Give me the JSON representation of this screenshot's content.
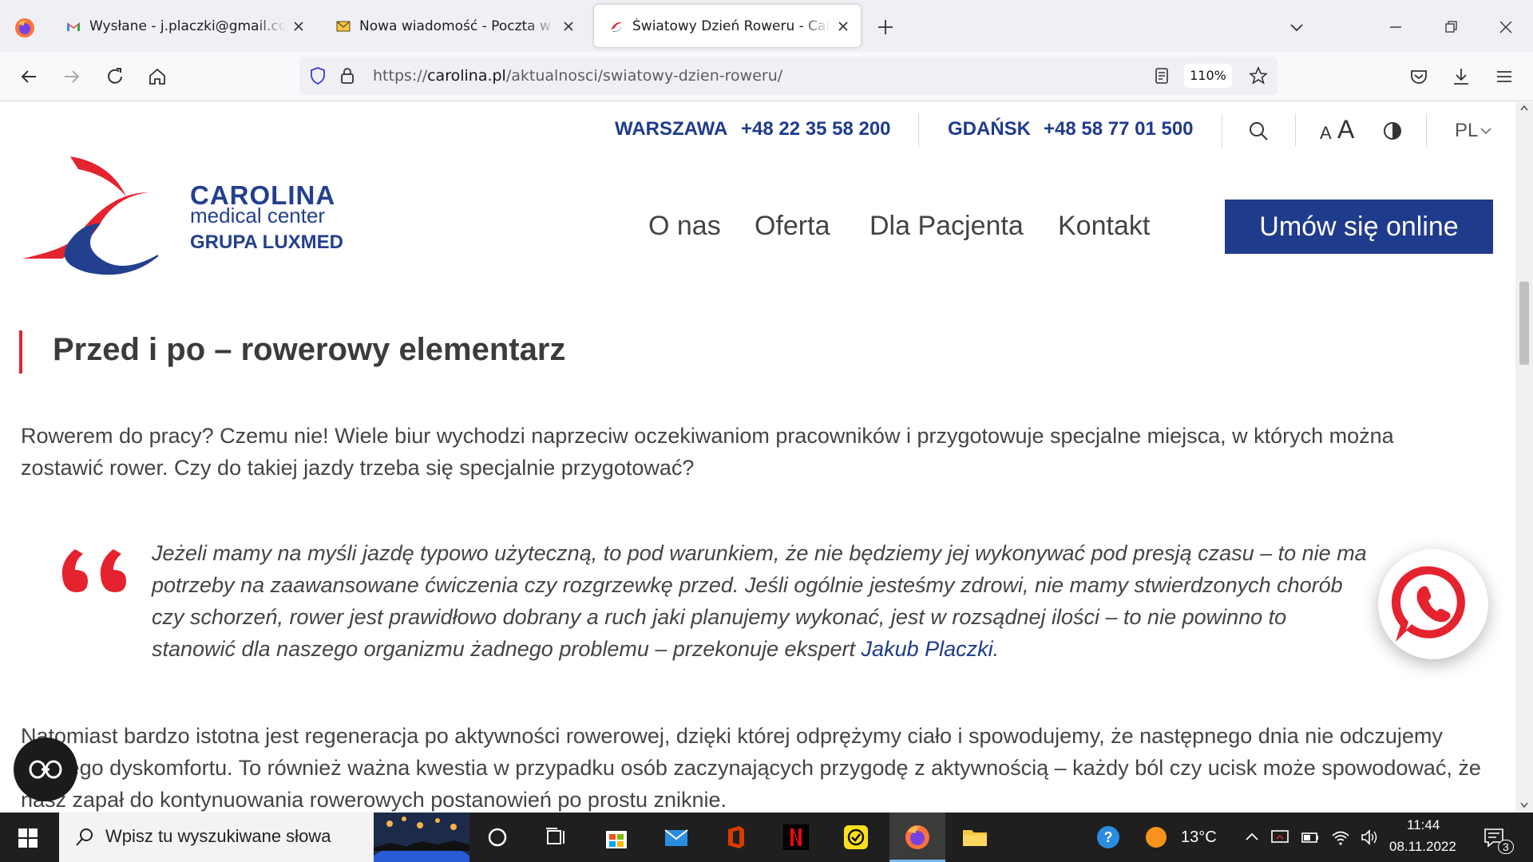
{
  "browser": {
    "tabs": [
      {
        "title": "Wysłane - j.placzki@gmail.com",
        "icon": "gmail-icon",
        "active": false
      },
      {
        "title": "Nowa wiadomość - Poczta w Onet",
        "icon": "mail-icon",
        "active": false
      },
      {
        "title": "Światowy Dzień Roweru - Carolina",
        "icon": "carolina-favicon",
        "active": true
      }
    ],
    "url_prefix": "https://",
    "url_domain": "carolina.pl",
    "url_path": "/aktualnosci/swiatowy-dzien-roweru/",
    "zoom": "110%"
  },
  "site": {
    "contacts": [
      {
        "city": "WARSZAWA",
        "phone": "+48 22 35  58 200"
      },
      {
        "city": "GDAŃSK",
        "phone": "+48 58 77  01 500"
      }
    ],
    "font_size_small": "A",
    "font_size_large": "A",
    "language": "PL",
    "logo": {
      "name": "CAROLINA",
      "subtitle": "medical center",
      "group": "GRUPA LUXMED"
    },
    "menu": [
      "O nas",
      "Oferta",
      "Dla Pacjenta",
      "Kontakt"
    ],
    "cta": "Umów się online",
    "colors": {
      "brand_blue": "#1f3b8c",
      "accent_red": "#e4232f"
    }
  },
  "article": {
    "section_title": "Przed i po – rowerowy elementarz",
    "intro": "Rowerem do pracy? Czemu nie! Wiele biur wychodzi naprzeciw oczekiwaniom pracowników i przygotowuje specjalne miejsca, w których można zostawić rower. Czy do takiej jazdy trzeba się specjalnie przygotować?",
    "quote_text": "Jeżeli mamy na myśli jazdę typowo użyteczną, to pod warunkiem, że nie będziemy jej wykonywać pod presją czasu – to nie ma potrzeby na zaawansowane ćwiczenia czy rozgrzewkę przed. Jeśli ogólnie jesteśmy zdrowi, nie mamy stwierdzonych chorób czy schorzeń, rower jest prawidłowo dobrany a ruch jaki planujemy wykonać, jest w rozsądnej ilości – to nie powinno to stanowić dla naszego organizmu żadnego problemu – przekonuje ekspert ",
    "quote_author": "Jakub Placzki",
    "quote_end": ".",
    "body": "Natomiast bardzo istotna jest regeneracja po aktywności rowerowej, dzięki której odprężymy ciało i spowodujemy, że następnego dnia nie odczujemy żadnego dyskomfortu. To również ważna kwestia w przypadku osób zaczynających przygodę z aktywnością – każdy ból czy ucisk może spowodować, że nasz zapał do kontynuowania rowerowych postanowień po prostu zniknie."
  },
  "taskbar": {
    "search_placeholder": "Wpisz tu wyszukiwane słowa",
    "weather": "13°C",
    "time": "11:44",
    "date": "08.11.2022",
    "notifications": "3"
  }
}
